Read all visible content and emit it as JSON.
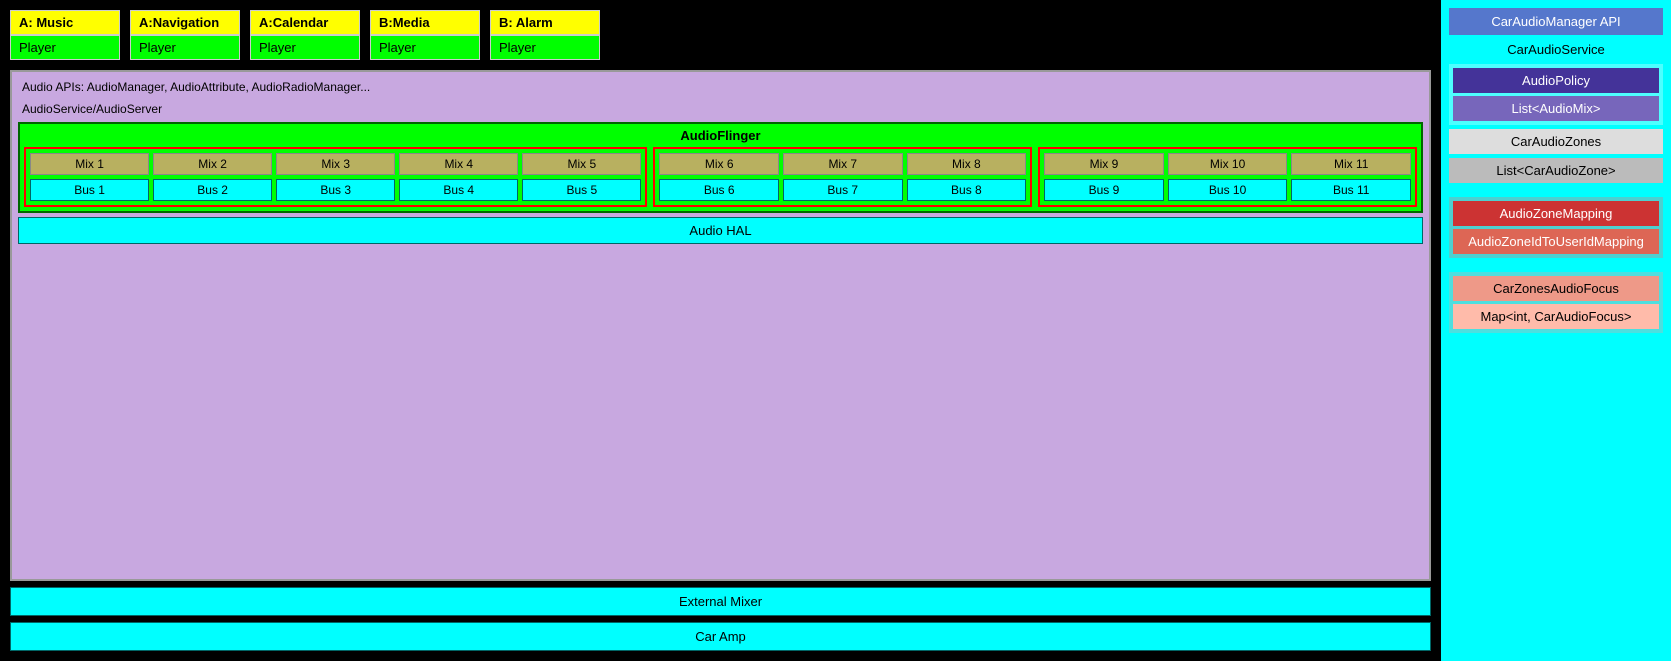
{
  "apps": [
    {
      "top": "A: Music",
      "bottom": "Player"
    },
    {
      "top": "A:Navigation",
      "bottom": "Player"
    },
    {
      "top": "A:Calendar",
      "bottom": "Player"
    },
    {
      "top": "B:Media",
      "bottom": "Player"
    },
    {
      "top": "B: Alarm",
      "bottom": "Player"
    }
  ],
  "arch": {
    "api_label": "Audio APIs: AudioManager, AudioAttribute, AudioRadioManager...",
    "server_label": "AudioService/AudioServer",
    "flinger_label": "AudioFlinger"
  },
  "zones": [
    {
      "mixes": [
        "Mix 1",
        "Mix 2",
        "Mix 3",
        "Mix 4",
        "Mix 5"
      ],
      "buses": [
        "Bus 1",
        "Bus 2",
        "Bus 3",
        "Bus 4",
        "Bus 5"
      ]
    },
    {
      "mixes": [
        "Mix 6",
        "Mix 7",
        "Mix 8"
      ],
      "buses": [
        "Bus 6",
        "Bus 7",
        "Bus 8"
      ]
    },
    {
      "mixes": [
        "Mix 9",
        "Mix 10",
        "Mix 11"
      ],
      "buses": [
        "Bus 9",
        "Bus 10",
        "Bus 11"
      ]
    }
  ],
  "audio_hal": "Audio HAL",
  "external_mixer": "External Mixer",
  "car_amp": "Car Amp",
  "right_panel": {
    "car_audio_manager_api": "CarAudioManager API",
    "car_audio_service": "CarAudioService",
    "audio_policy": "AudioPolicy",
    "list_audio_mix": "List<AudioMix>",
    "car_audio_zones": "CarAudioZones",
    "list_car_audio_zone": "List<CarAudioZone>",
    "audio_zone_mapping": "AudioZoneMapping",
    "audio_zone_id_to_user_id": "AudioZoneIdToUserIdMapping",
    "car_zones_audio_focus": "CarZonesAudioFocus",
    "map_car_audio_focus": "Map<int, CarAudioFocus>"
  }
}
